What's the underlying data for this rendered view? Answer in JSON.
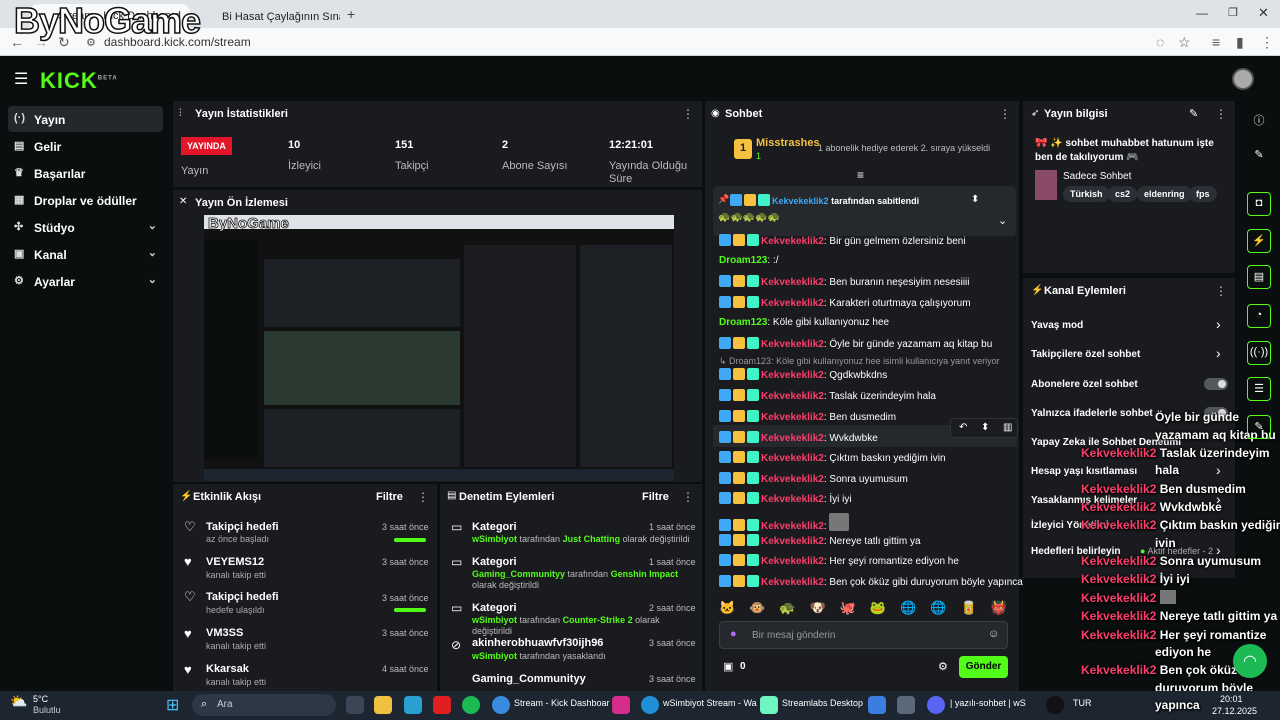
{
  "browser": {
    "tab1": "Stream - Kick Dashboard",
    "tab2": "Bi Hasat Çaylağının Sınavı! 😱",
    "url": "dashboard.kick.com/stream",
    "overlay_logo": "ByNoGame"
  },
  "kick": {
    "logo": "KICK",
    "beta": "BETA"
  },
  "sidebar": {
    "items": [
      {
        "label": "Yayın",
        "icon": "broadcast-icon"
      },
      {
        "label": "Gelir",
        "icon": "revenue-icon"
      },
      {
        "label": "Başarılar",
        "icon": "trophy-icon"
      },
      {
        "label": "Droplar ve ödüller",
        "icon": "gift-icon"
      },
      {
        "label": "Stüdyo",
        "icon": "studio-icon"
      },
      {
        "label": "Kanal",
        "icon": "channel-icon"
      },
      {
        "label": "Ayarlar",
        "icon": "settings-icon"
      }
    ]
  },
  "stats": {
    "title": "Yayın İstatistikleri",
    "live_badge": "YAYINDA",
    "live_label": "Yayın",
    "viewers": "10",
    "viewers_label": "İzleyici",
    "followers": "151",
    "followers_label": "Takipçi",
    "subs": "2",
    "subs_label": "Abone Sayısı",
    "duration": "12:21:01",
    "duration_label": "Yayında Olduğu Süre"
  },
  "preview": {
    "title": "Yayın Ön İzlemesi"
  },
  "activity": {
    "title": "Etkinlik Akışı",
    "filter": "Filtre",
    "items": [
      {
        "title": "Takipçi hedefi",
        "sub": "az önce başladı",
        "time": "3 saat önce"
      },
      {
        "title": "VEYEMS12",
        "sub": "kanalı takip etti",
        "time": "3 saat önce"
      },
      {
        "title": "Takipçi hedefi",
        "sub": "hedefe ulaşıldı",
        "time": "3 saat önce"
      },
      {
        "title": "VM3SS",
        "sub": "kanalı takip etti",
        "time": "3 saat önce"
      },
      {
        "title": "Kkarsak",
        "sub": "kanalı takip etti",
        "time": "4 saat önce"
      }
    ]
  },
  "moderation": {
    "title": "Denetim Eylemleri",
    "filter": "Filtre",
    "items": [
      {
        "title": "Kategori",
        "time": "1 saat önce",
        "actor": "wSimbiyot",
        "mid": " tarafından ",
        "value": "Just Chatting",
        "tail": " olarak değiştirildi"
      },
      {
        "title": "Kategori",
        "time": "1 saat önce",
        "actor": "Gaming_Communityy",
        "mid": " tarafından ",
        "value": "Genshin Impact",
        "tail": " olarak değiştirildi"
      },
      {
        "title": "Kategori",
        "time": "2 saat önce",
        "actor": "wSimbiyot",
        "mid": " tarafından ",
        "value": "Counter-Strike 2",
        "tail": " olarak değiştirildi"
      },
      {
        "title": "akinherobhuawfvf30ijh96",
        "time": "3 saat önce",
        "actor": "wSimbiyot",
        "mid": " tarafından yasaklandı",
        "value": "",
        "tail": ""
      },
      {
        "title": "Gaming_Communityy",
        "time": "3 saat önce",
        "actor": "",
        "mid": "",
        "value": "",
        "tail": ""
      }
    ]
  },
  "chat": {
    "title": "Sohbet",
    "top_user": "Misstrashes",
    "top_rank": "1",
    "top_count": "1",
    "top_note": "1 abonelik hediye ederek 2. sıraya yükseldi",
    "pinned_by": "Kekvekeklik2",
    "pinned_label": "tarafından sabitlendi",
    "reply_note": "Droam123: Köle gibi kullanıyonuz hee isimli kullanıcıya yanıt veriyor",
    "messages": [
      {
        "user": "Kekvekeklik2",
        "text": "Bir gün gelmem özlersiniz beni",
        "type": "badge"
      },
      {
        "user": "Droam123",
        "text": ":/",
        "type": "green"
      },
      {
        "user": "Kekvekeklik2",
        "text": "Ben buranın neşesiyim nesesiiii",
        "type": "badge"
      },
      {
        "user": "Kekvekeklik2",
        "text": "Karakteri oturtmaya çalışıyorum",
        "type": "badge"
      },
      {
        "user": "Droam123",
        "text": "Köle gibi kullanıyonuz hee",
        "type": "green"
      },
      {
        "user": "Kekvekeklik2",
        "text": "Öyle bir günde yazamam aq kitap bu",
        "type": "badge"
      },
      {
        "user": "Kekvekeklik2",
        "text": "Qgdkwbkdns",
        "type": "badge"
      },
      {
        "user": "Kekvekeklik2",
        "text": "Taslak üzerindeyim hala",
        "type": "badge"
      },
      {
        "user": "Kekvekeklik2",
        "text": "Ben dusmedim",
        "type": "badge"
      },
      {
        "user": "Kekvekeklik2",
        "text": "Wvkdwbke",
        "type": "badge"
      },
      {
        "user": "Kekvekeklik2",
        "text": "Çıktım baskın yediğim ivin",
        "type": "badge"
      },
      {
        "user": "Kekvekeklik2",
        "text": "Sonra uyumusum",
        "type": "badge"
      },
      {
        "user": "Kekvekeklik2",
        "text": "İyi iyi",
        "type": "badge"
      },
      {
        "user": "Kekvekeklik2",
        "text": "",
        "type": "badge"
      },
      {
        "user": "Kekvekeklik2",
        "text": "Nereye tatlı gittim ya",
        "type": "badge"
      },
      {
        "user": "Kekvekeklik2",
        "text": "Her şeyi romantize ediyon he",
        "type": "badge"
      },
      {
        "user": "Kekvekeklik2",
        "text": "Ben çok öküz gibi duruyorum böyle yapınca",
        "type": "badge"
      }
    ],
    "input_placeholder": "Bir mesaj gönderin",
    "points": "0",
    "send": "Gönder"
  },
  "info": {
    "title": "Yayın bilgisi",
    "stream_title": "sohbet muhabbet hatunum işte ben de takılıyorum",
    "category": "Sadece Sohbet",
    "tags": [
      "Türkish",
      "cs2",
      "eldenring",
      "fps"
    ]
  },
  "actions": {
    "title": "Kanal Eylemleri",
    "items": [
      {
        "label": "Yavaş mod",
        "kind": "arrow"
      },
      {
        "label": "Takipçilere özel sohbet",
        "kind": "arrow"
      },
      {
        "label": "Abonelere özel sohbet",
        "kind": "toggle"
      },
      {
        "label": "Yalnızca ifadelerle sohbet",
        "kind": "toggle"
      },
      {
        "label": "Yapay Zeka ile Sohbet Denetimi",
        "kind": "arrow"
      },
      {
        "label": "Hesap yaşı kısıtlaması",
        "kind": "arrow"
      },
      {
        "label": "Yasaklanmış kelimeler",
        "kind": "arrow"
      },
      {
        "label": "İzleyici Yönetimi",
        "kind": "arrow"
      },
      {
        "label": "Hedefleri belirleyin",
        "kind": "arrow",
        "extra": "Aktif hedefler - 2"
      }
    ]
  },
  "overlay_chat": [
    {
      "user": "",
      "text": "Öyle bir günde"
    },
    {
      "user": "",
      "text": "yazamam aq kitap bu"
    },
    {
      "user": "Kekvekeklik2",
      "text": "Taslak üzerindeyim"
    },
    {
      "user": "",
      "text": "hala"
    },
    {
      "user": "Kekvekeklik2",
      "text": "Ben dusmedim"
    },
    {
      "user": "Kekvekeklik2",
      "text": "Wvkdwbke"
    },
    {
      "user": "Kekvekeklik2",
      "text": "Çıktım baskın yediğim"
    },
    {
      "user": "",
      "text": "ivin"
    },
    {
      "user": "Kekvekeklik2",
      "text": "Sonra uyumusum"
    },
    {
      "user": "Kekvekeklik2",
      "text": "İyi iyi"
    },
    {
      "user": "Kekvekeklik2",
      "text": ""
    },
    {
      "user": "Kekvekeklik2",
      "text": "Nereye tatlı gittim ya"
    },
    {
      "user": "Kekvekeklik2",
      "text": "Her şeyi romantize"
    },
    {
      "user": "",
      "text": "ediyon he"
    },
    {
      "user": "Kekvekeklik2",
      "text": "Ben çok öküz gibi"
    },
    {
      "user": "",
      "text": "duruyorum böyle"
    },
    {
      "user": "",
      "text": "yapınca"
    }
  ],
  "taskbar": {
    "weather_temp": "5°C",
    "weather_desc": "Bulutlu",
    "search": "Ara",
    "chrome": "Stream - Kick Dashboar",
    "edge": "wSimbiyot Stream - Wa",
    "streamlabs": "Streamlabs Desktop",
    "discord": "| yazılı-sohbet | wS",
    "lang": "TUR",
    "time": "20:01",
    "date": "27.12.2025"
  },
  "colors": {
    "accent": "#53fc18",
    "live": "#e3152a",
    "username": "#ff3d6b"
  }
}
